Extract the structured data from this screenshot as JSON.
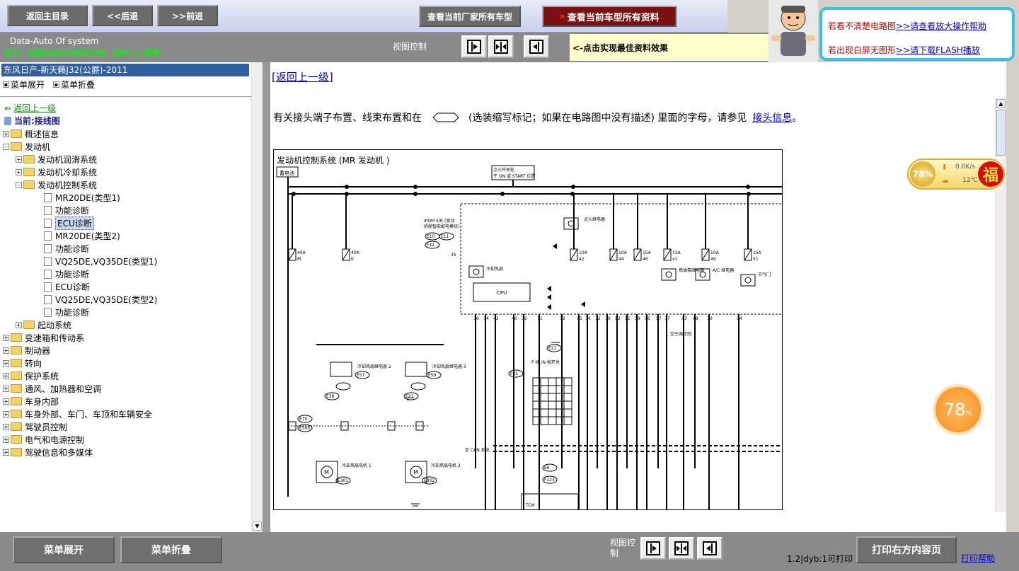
{
  "nav": {
    "home": "返回主目录",
    "back": "<<后退",
    "forward": ">>前进",
    "all_models": "查看当前厂家所有车型",
    "all_docs": "查看当前车型所有资料"
  },
  "system": {
    "name": "Data-Auto Of system",
    "notice": "提示：随意拖放中边框至右侧，随你\"口\"翻看"
  },
  "view_control_label": "视图控制",
  "tip": "<-点击实现最佳资料效果",
  "help": {
    "line1_text": "若看不清楚电路图",
    "line1_link": ">>请查看放大操作帮助",
    "line2_text": "若出现白屏无图形",
    "line2_link": ">>请下载FLASH播放"
  },
  "sidebar": {
    "vehicle": "东风日产-新天籁J32(公爵)-2011",
    "expand": "菜单展开",
    "collapse": "菜单折叠",
    "back": "返回上一级",
    "current": "当前:接线图",
    "tree": [
      {
        "label": "概述信息",
        "level": 0,
        "type": "folder",
        "exp": "+"
      },
      {
        "label": "发动机",
        "level": 0,
        "type": "folder",
        "exp": "-"
      },
      {
        "label": "发动机润滑系统",
        "level": 1,
        "type": "folder",
        "exp": "+"
      },
      {
        "label": "发动机冷却系统",
        "level": 1,
        "type": "folder",
        "exp": "+"
      },
      {
        "label": "发动机控制系统",
        "level": 1,
        "type": "folder",
        "exp": "-"
      },
      {
        "label": "MR20DE(类型1)",
        "level": 2,
        "type": "doc"
      },
      {
        "label": "功能诊断",
        "level": 2,
        "type": "doc"
      },
      {
        "label": "ECU诊断",
        "level": 2,
        "type": "doc",
        "selected": true
      },
      {
        "label": "MR20DE(类型2)",
        "level": 2,
        "type": "doc"
      },
      {
        "label": "功能诊断",
        "level": 2,
        "type": "doc"
      },
      {
        "label": "VQ25DE,VQ35DE(类型1)",
        "level": 2,
        "type": "doc"
      },
      {
        "label": "功能诊断",
        "level": 2,
        "type": "doc"
      },
      {
        "label": "ECU诊断",
        "level": 2,
        "type": "doc"
      },
      {
        "label": "VQ25DE,VQ35DE(类型2)",
        "level": 2,
        "type": "doc"
      },
      {
        "label": "功能诊断",
        "level": 2,
        "type": "doc"
      },
      {
        "label": "起动系统",
        "level": 1,
        "type": "folder",
        "exp": "+"
      },
      {
        "label": "变速箱和传动系",
        "level": 0,
        "type": "folder",
        "exp": "+"
      },
      {
        "label": "制动器",
        "level": 0,
        "type": "folder",
        "exp": "+"
      },
      {
        "label": "转向",
        "level": 0,
        "type": "folder",
        "exp": "+"
      },
      {
        "label": "保护系统",
        "level": 0,
        "type": "folder",
        "exp": "+"
      },
      {
        "label": "通风、加热器和空调",
        "level": 0,
        "type": "folder",
        "exp": "+"
      },
      {
        "label": "车身内部",
        "level": 0,
        "type": "folder",
        "exp": "+"
      },
      {
        "label": "车身外部、车门、车顶和车辆安全",
        "level": 0,
        "type": "folder",
        "exp": "+"
      },
      {
        "label": "驾驶员控制",
        "level": 0,
        "type": "folder",
        "exp": "+"
      },
      {
        "label": "电气和电源控制",
        "level": 0,
        "type": "folder",
        "exp": "+"
      },
      {
        "label": "驾驶信息和多媒体",
        "level": 0,
        "type": "folder",
        "exp": "+"
      }
    ]
  },
  "main": {
    "back_link": "[返回上一级]",
    "desc_before": "有关接头端子布置、线束布置和在",
    "desc_after": "(选装缩写标记；如果在电路图中没有描述) 里面的字母，请参见",
    "desc_link": "接头信息",
    "desc_end": "。",
    "diagram": {
      "title": "发动机控制系统 (MR 发动机 )",
      "battery": "蓄电池",
      "ign": "点火开关处于 ON 或 START 位置",
      "ipdm": "IPDM E/R (发动机舱智能配电模块)",
      "cpu": "CPU",
      "fuses": [
        "40A",
        "40A",
        "10A",
        "10A",
        "15A",
        "15A",
        "10A",
        "15A"
      ],
      "fuse_ids": [
        "M",
        "K",
        "42",
        "44",
        "46",
        "41",
        "49",
        "51"
      ],
      "relays": [
        "点火继电器",
        "冷却风扇继电器 1",
        "冷却风扇继电器 2",
        "冷却风扇继电器 3",
        "燃油泵继电器",
        "A/C 继电器",
        "节气门控制电机继电器"
      ],
      "motors": [
        "冷却风扇电机 1",
        "冷却风扇电机 2"
      ],
      "connectors": [
        "E10",
        "E11",
        "F12",
        "E57",
        "E59",
        "E38",
        "E21",
        "E70",
        "E300",
        "E301",
        "E302",
        "E6",
        "F123",
        "E21",
        "F21"
      ],
      "pins": [
        "35",
        "36",
        "34",
        "42",
        "40",
        "39",
        "11",
        "12",
        "15",
        "74",
        "72",
        "30",
        "52",
        "51",
        "19",
        "56",
        "57",
        "77",
        "13",
        "48",
        "70",
        "54"
      ],
      "prnd": "P 档 /N 档开关",
      "can": "至 CAN 系统",
      "ac": "至空调控制",
      "tcm": "TCM"
    }
  },
  "widgets": {
    "cpu_pct": "78%",
    "speed": "0.0K/s",
    "temp": "12℃",
    "fu": "福",
    "boost": "78"
  },
  "bottom": {
    "expand": "菜单展开",
    "collapse": "菜单折叠",
    "view_label": "视图控制",
    "page_info": "1.2|dyb:1可打印",
    "print": "打印右方内容页",
    "print_help": "打印帮助"
  },
  "colors": {
    "toolbar": "#6b6b6b",
    "tree_selected": "#2f5f9f",
    "help_border": "#3cc0e0",
    "link": "#0000cc"
  }
}
